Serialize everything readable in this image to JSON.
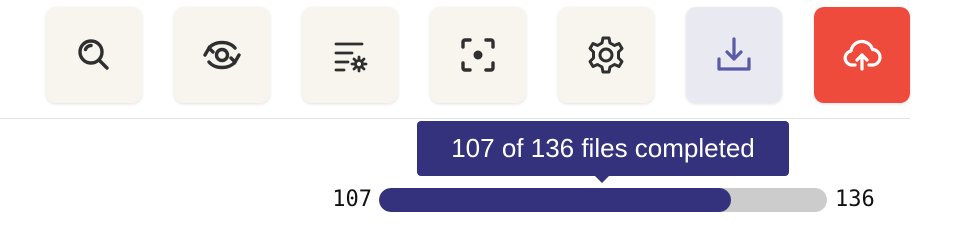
{
  "toolbar": {
    "buttons": [
      {
        "icon": "search-icon"
      },
      {
        "icon": "eye-refresh-icon"
      },
      {
        "icon": "filter-settings-icon"
      },
      {
        "icon": "focus-capture-icon"
      },
      {
        "icon": "gear-icon"
      },
      {
        "icon": "download-icon"
      },
      {
        "icon": "cloud-upload-icon"
      }
    ]
  },
  "colors": {
    "accent": "#34327c",
    "primary_button": "#ee4b3d",
    "track": "#cccccc",
    "tool_bg": "#f8f5ef"
  },
  "progress": {
    "tooltip": "107 of 136 files completed",
    "completed": "107",
    "total": "136",
    "fraction": 0.7868
  }
}
